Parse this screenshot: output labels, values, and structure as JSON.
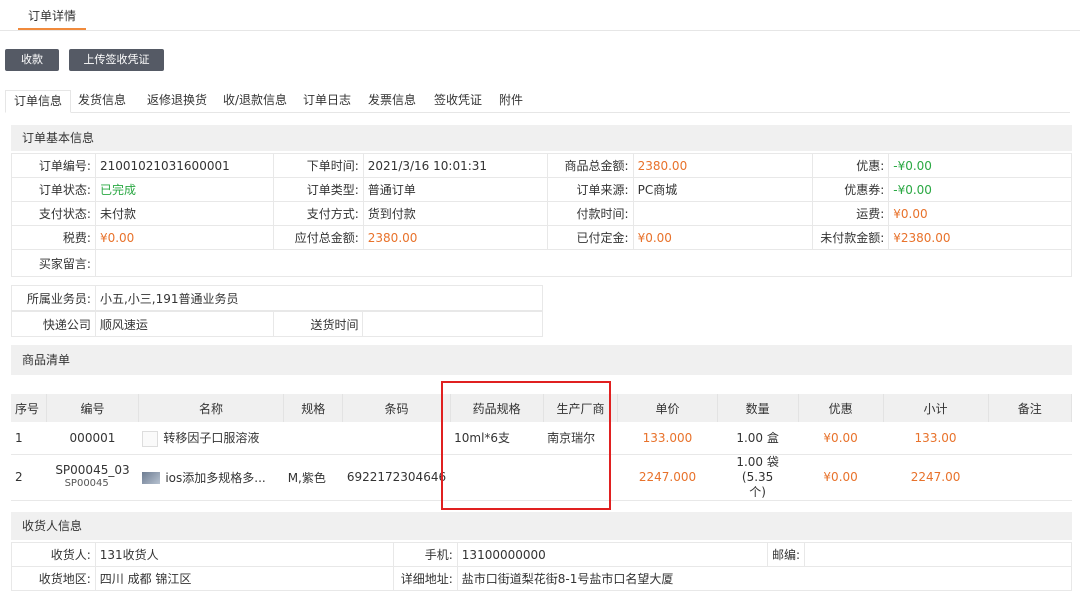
{
  "page_tab": "订单详情",
  "buttons": {
    "collect": "收款",
    "upload": "上传签收凭证"
  },
  "sub_tabs": [
    "订单信息",
    "发货信息",
    "返修退换货",
    "收/退款信息",
    "订单日志",
    "发票信息",
    "签收凭证",
    "附件"
  ],
  "basic": {
    "title": "订单基本信息",
    "order_no_l": "订单编号:",
    "order_no": "21001021031600001",
    "order_time_l": "下单时间:",
    "order_time": "2021/3/16 10:01:31",
    "total_l": "商品总金额:",
    "total": "2380.00",
    "discount_l": "优惠:",
    "discount": "-¥0.00",
    "status_l": "订单状态:",
    "status": "已完成",
    "type_l": "订单类型:",
    "type": "普通订单",
    "source_l": "订单来源:",
    "source": "PC商城",
    "coupon_l": "优惠券:",
    "coupon": "-¥0.00",
    "pay_status_l": "支付状态:",
    "pay_status": "未付款",
    "pay_method_l": "支付方式:",
    "pay_method": "货到付款",
    "pay_time_l": "付款时间:",
    "pay_time": "",
    "freight_l": "运费:",
    "freight": "¥0.00",
    "tax_l": "税费:",
    "tax": "¥0.00",
    "payable_l": "应付总金额:",
    "payable": "2380.00",
    "deposit_l": "已付定金:",
    "deposit": "¥0.00",
    "unpaid_l": "未付款金额:",
    "unpaid": "¥2380.00",
    "msg_l": "买家留言:",
    "sales_l": "所属业务员:",
    "sales": "小五,小三,191普通业务员",
    "express_l": "快递公司",
    "express": "顺风速运",
    "delivery_time_l": "送货时间"
  },
  "goods": {
    "title": "商品清单",
    "headers": [
      "序号",
      "编号",
      "名称",
      "规格",
      "条码",
      "药品规格",
      "生产厂商",
      "单价",
      "数量",
      "优惠",
      "小计",
      "备注"
    ],
    "rows": [
      {
        "idx": "1",
        "code": "000001",
        "code2": "",
        "name": "转移因子口服溶液",
        "spec": "",
        "barcode": "",
        "drug_spec": "10ml*6支",
        "maker": "南京瑞尔",
        "price": "133.000",
        "qty": "1.00 盒",
        "qty2": "",
        "disc": "¥0.00",
        "subtotal": "133.00",
        "note": ""
      },
      {
        "idx": "2",
        "code": "SP00045_03",
        "code2": "SP00045",
        "name": "ios添加多规格多...",
        "spec": "M,紫色",
        "barcode": "6922172304646",
        "drug_spec": "",
        "maker": "",
        "price": "2247.000",
        "qty": "1.00 袋(5.35",
        "qty2": "个)",
        "disc": "¥0.00",
        "subtotal": "2247.00",
        "note": ""
      }
    ]
  },
  "receiver": {
    "title": "收货人信息",
    "name_l": "收货人:",
    "name": "131收货人",
    "phone_l": "手机:",
    "phone": "13100000000",
    "zip_l": "邮编:",
    "zip": "",
    "area_l": "收货地区:",
    "area": "四川 成都 锦江区",
    "addr_l": "详细地址:",
    "addr": "盐市口街道梨花街8-1号盐市口名望大厦"
  }
}
